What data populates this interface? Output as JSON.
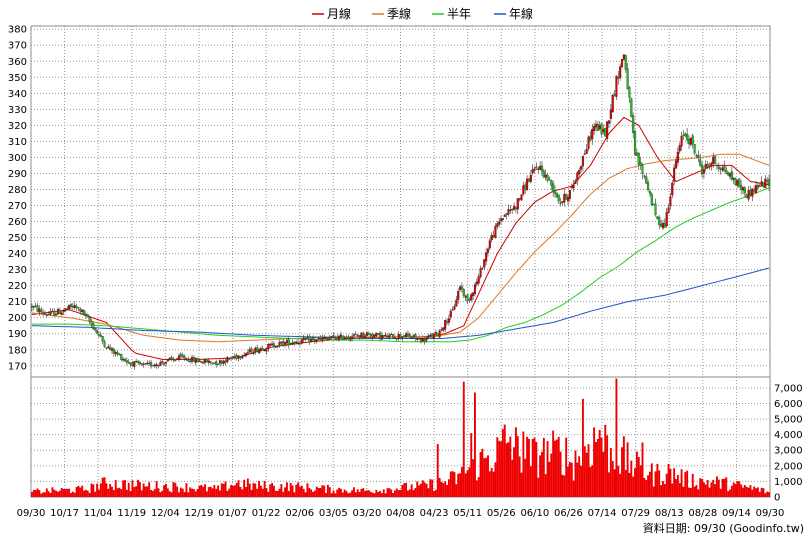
{
  "chart_data": {
    "type": "candlestick",
    "legend": [
      {
        "name": "月線",
        "color": "#cc0000"
      },
      {
        "name": "季線",
        "color": "#dd7722"
      },
      {
        "name": "半年",
        "color": "#22cc22"
      },
      {
        "name": "年線",
        "color": "#2255cc"
      }
    ],
    "legend_position": "top-center",
    "price_axis": {
      "ylim": [
        163,
        382
      ],
      "ticks": [
        170,
        180,
        190,
        200,
        210,
        220,
        230,
        240,
        250,
        260,
        270,
        280,
        290,
        300,
        310,
        320,
        330,
        340,
        350,
        360,
        370,
        380
      ]
    },
    "volume_axis": {
      "ylim": [
        0,
        7700
      ],
      "ticks": [
        0,
        1000,
        2000,
        3000,
        4000,
        5000,
        6000,
        7000
      ],
      "tick_labels": [
        "0",
        "1,000",
        "2,000",
        "3,000",
        "4,000",
        "5,000",
        "6,000",
        "7,000"
      ]
    },
    "x_tick_labels": [
      "09/30",
      "10/17",
      "11/04",
      "11/19",
      "12/04",
      "12/19",
      "01/07",
      "01/22",
      "02/06",
      "03/05",
      "03/20",
      "04/08",
      "04/23",
      "05/11",
      "05/26",
      "06/10",
      "06/26",
      "07/14",
      "07/29",
      "08/13",
      "08/28",
      "09/14",
      "09/30"
    ],
    "grid": true,
    "colors": {
      "up": "#dd0000",
      "down": "#22bb22",
      "volume": "#ee0000",
      "grid": "#999999"
    },
    "price_keypoints": [
      [
        0,
        207
      ],
      [
        8,
        202
      ],
      [
        16,
        204
      ],
      [
        22,
        207
      ],
      [
        26,
        205
      ],
      [
        32,
        196
      ],
      [
        40,
        182
      ],
      [
        46,
        177
      ],
      [
        52,
        172
      ],
      [
        60,
        170
      ],
      [
        70,
        172
      ],
      [
        80,
        175
      ],
      [
        90,
        173
      ],
      [
        100,
        172
      ],
      [
        110,
        176
      ],
      [
        120,
        180
      ],
      [
        130,
        183
      ],
      [
        140,
        185
      ],
      [
        150,
        186
      ],
      [
        160,
        187
      ],
      [
        170,
        188
      ],
      [
        180,
        190
      ],
      [
        190,
        188
      ],
      [
        200,
        189
      ],
      [
        210,
        186
      ],
      [
        218,
        190
      ],
      [
        226,
        204
      ],
      [
        230,
        220
      ],
      [
        234,
        210
      ],
      [
        240,
        225
      ],
      [
        246,
        248
      ],
      [
        252,
        262
      ],
      [
        260,
        270
      ],
      [
        266,
        285
      ],
      [
        272,
        295
      ],
      [
        278,
        285
      ],
      [
        284,
        272
      ],
      [
        290,
        280
      ],
      [
        296,
        300
      ],
      [
        302,
        320
      ],
      [
        308,
        315
      ],
      [
        314,
        348
      ],
      [
        318,
        365
      ],
      [
        320,
        345
      ],
      [
        324,
        302
      ],
      [
        330,
        285
      ],
      [
        336,
        260
      ],
      [
        340,
        258
      ],
      [
        346,
        298
      ],
      [
        350,
        315
      ],
      [
        354,
        310
      ],
      [
        360,
        292
      ],
      [
        366,
        298
      ],
      [
        372,
        292
      ],
      [
        378,
        285
      ],
      [
        384,
        277
      ],
      [
        390,
        282
      ],
      [
        396,
        285
      ]
    ],
    "ma_month": [
      [
        0,
        202
      ],
      [
        20,
        205
      ],
      [
        40,
        197
      ],
      [
        55,
        178
      ],
      [
        70,
        174
      ],
      [
        90,
        174
      ],
      [
        110,
        175
      ],
      [
        130,
        182
      ],
      [
        150,
        185
      ],
      [
        170,
        187
      ],
      [
        190,
        188
      ],
      [
        210,
        188
      ],
      [
        222,
        190
      ],
      [
        232,
        195
      ],
      [
        240,
        215
      ],
      [
        250,
        240
      ],
      [
        260,
        259
      ],
      [
        270,
        272
      ],
      [
        280,
        279
      ],
      [
        290,
        282
      ],
      [
        300,
        295
      ],
      [
        310,
        315
      ],
      [
        318,
        325
      ],
      [
        326,
        320
      ],
      [
        336,
        300
      ],
      [
        346,
        285
      ],
      [
        356,
        290
      ],
      [
        366,
        295
      ],
      [
        376,
        295
      ],
      [
        386,
        285
      ],
      [
        396,
        283
      ]
    ],
    "ma_quarter": [
      [
        0,
        203
      ],
      [
        20,
        200
      ],
      [
        40,
        196
      ],
      [
        60,
        189
      ],
      [
        80,
        186
      ],
      [
        100,
        185
      ],
      [
        120,
        186
      ],
      [
        140,
        187
      ],
      [
        160,
        188
      ],
      [
        180,
        188
      ],
      [
        200,
        188
      ],
      [
        215,
        188
      ],
      [
        230,
        191
      ],
      [
        240,
        200
      ],
      [
        250,
        214
      ],
      [
        260,
        228
      ],
      [
        270,
        241
      ],
      [
        280,
        252
      ],
      [
        290,
        264
      ],
      [
        300,
        277
      ],
      [
        310,
        287
      ],
      [
        320,
        293
      ],
      [
        330,
        296
      ],
      [
        340,
        298
      ],
      [
        350,
        299
      ],
      [
        360,
        300
      ],
      [
        370,
        302
      ],
      [
        380,
        302
      ],
      [
        396,
        295
      ]
    ],
    "ma_half": [
      [
        0,
        196
      ],
      [
        20,
        196
      ],
      [
        40,
        195
      ],
      [
        60,
        193
      ],
      [
        80,
        191
      ],
      [
        100,
        189
      ],
      [
        120,
        188
      ],
      [
        140,
        187
      ],
      [
        160,
        186
      ],
      [
        180,
        186
      ],
      [
        200,
        185
      ],
      [
        215,
        185
      ],
      [
        225,
        185
      ],
      [
        235,
        186
      ],
      [
        245,
        189
      ],
      [
        255,
        194
      ],
      [
        265,
        197
      ],
      [
        275,
        202
      ],
      [
        285,
        208
      ],
      [
        295,
        216
      ],
      [
        305,
        225
      ],
      [
        315,
        232
      ],
      [
        325,
        241
      ],
      [
        335,
        248
      ],
      [
        345,
        256
      ],
      [
        355,
        262
      ],
      [
        365,
        267
      ],
      [
        375,
        272
      ],
      [
        385,
        276
      ],
      [
        396,
        281
      ]
    ],
    "ma_year": [
      [
        0,
        195
      ],
      [
        30,
        194
      ],
      [
        60,
        192
      ],
      [
        90,
        191
      ],
      [
        120,
        189
      ],
      [
        150,
        188
      ],
      [
        180,
        187
      ],
      [
        200,
        187
      ],
      [
        220,
        187
      ],
      [
        240,
        189
      ],
      [
        260,
        193
      ],
      [
        280,
        197
      ],
      [
        300,
        204
      ],
      [
        320,
        210
      ],
      [
        340,
        214
      ],
      [
        360,
        220
      ],
      [
        380,
        226
      ],
      [
        396,
        231
      ]
    ],
    "volume_keypoints": [
      [
        0,
        350
      ],
      [
        30,
        500
      ],
      [
        40,
        900
      ],
      [
        60,
        700
      ],
      [
        80,
        650
      ],
      [
        100,
        500
      ],
      [
        110,
        900
      ],
      [
        120,
        700
      ],
      [
        140,
        650
      ],
      [
        160,
        500
      ],
      [
        180,
        400
      ],
      [
        200,
        600
      ],
      [
        210,
        700
      ],
      [
        220,
        900
      ],
      [
        230,
        1300
      ],
      [
        240,
        2200
      ],
      [
        250,
        2800
      ],
      [
        256,
        3700
      ],
      [
        262,
        2800
      ],
      [
        270,
        2600
      ],
      [
        280,
        2800
      ],
      [
        286,
        2900
      ],
      [
        290,
        2100
      ],
      [
        298,
        3300
      ],
      [
        306,
        3800
      ],
      [
        312,
        2500
      ],
      [
        320,
        2300
      ],
      [
        326,
        1800
      ],
      [
        334,
        1400
      ],
      [
        340,
        1600
      ],
      [
        346,
        1400
      ],
      [
        352,
        1100
      ],
      [
        360,
        1000
      ],
      [
        370,
        900
      ],
      [
        380,
        700
      ],
      [
        390,
        500
      ],
      [
        396,
        300
      ]
    ],
    "volume_spikes": [
      [
        218,
        3400
      ],
      [
        232,
        7400
      ],
      [
        236,
        4100
      ],
      [
        264,
        4200
      ],
      [
        274,
        2900
      ],
      [
        296,
        6300
      ],
      [
        305,
        4300
      ],
      [
        314,
        7600
      ],
      [
        318,
        3900
      ],
      [
        328,
        3500
      ],
      [
        238,
        6700
      ]
    ],
    "source_label": "資料日期: 09/30 (Goodinfo.tw)"
  }
}
